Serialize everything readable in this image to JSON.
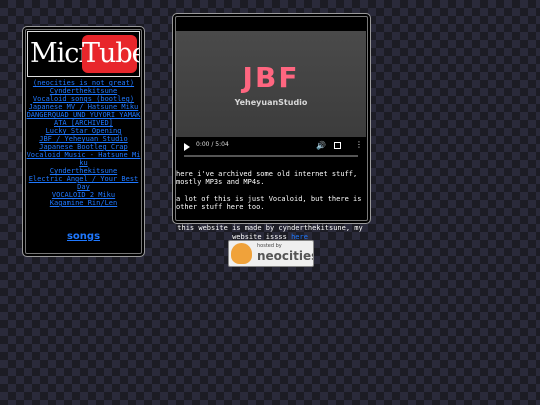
{
  "sidebar": {
    "logo": {
      "left_text": "Micro",
      "right_text": "Tube"
    },
    "links": [
      "(neocities is not great)",
      "Cynderthekitsune",
      "Vocaloid songs (bootleg)",
      "Japanese MV / Hatsune Miku",
      "DANGERQUAD UND YUYORI YAMAKATA [ARCHIVED]",
      "Lucky Star Opening",
      "JBF / Yeheyuan Studio",
      "Japanese Bootleg Crap",
      "Vocaloid Music - Hatsune Miku",
      "Cynderthekitsune",
      "Electric Angel / Your Best Day",
      "VOCALOID 2 Miku",
      "Kagamine Rin/Len"
    ],
    "songs_label": "songs"
  },
  "main": {
    "video": {
      "title_prefix": "JB",
      "title_highlight": "F",
      "subtitle": "YeheyuanStudio",
      "time": "0:00 / 5:04",
      "progress": 0
    },
    "description": [
      "here i've archived some old internet stuff, mostly MP3s and MP4s.",
      "a lot of this is just Vocaloid, but there is other stuff here too."
    ]
  },
  "footer": {
    "text": "this website is made by cynderthekitsune, my website issss",
    "link": "here"
  },
  "neocities": {
    "hosted_by": "hosted by",
    "name": "neocities"
  },
  "colors": {
    "link": "#1f78ff",
    "logo_red": "#e8262b",
    "background": "#1c1c24"
  },
  "icons": [
    "play-icon",
    "volume-icon",
    "fullscreen-icon",
    "more-icon",
    "neocities-cat-icon"
  ]
}
